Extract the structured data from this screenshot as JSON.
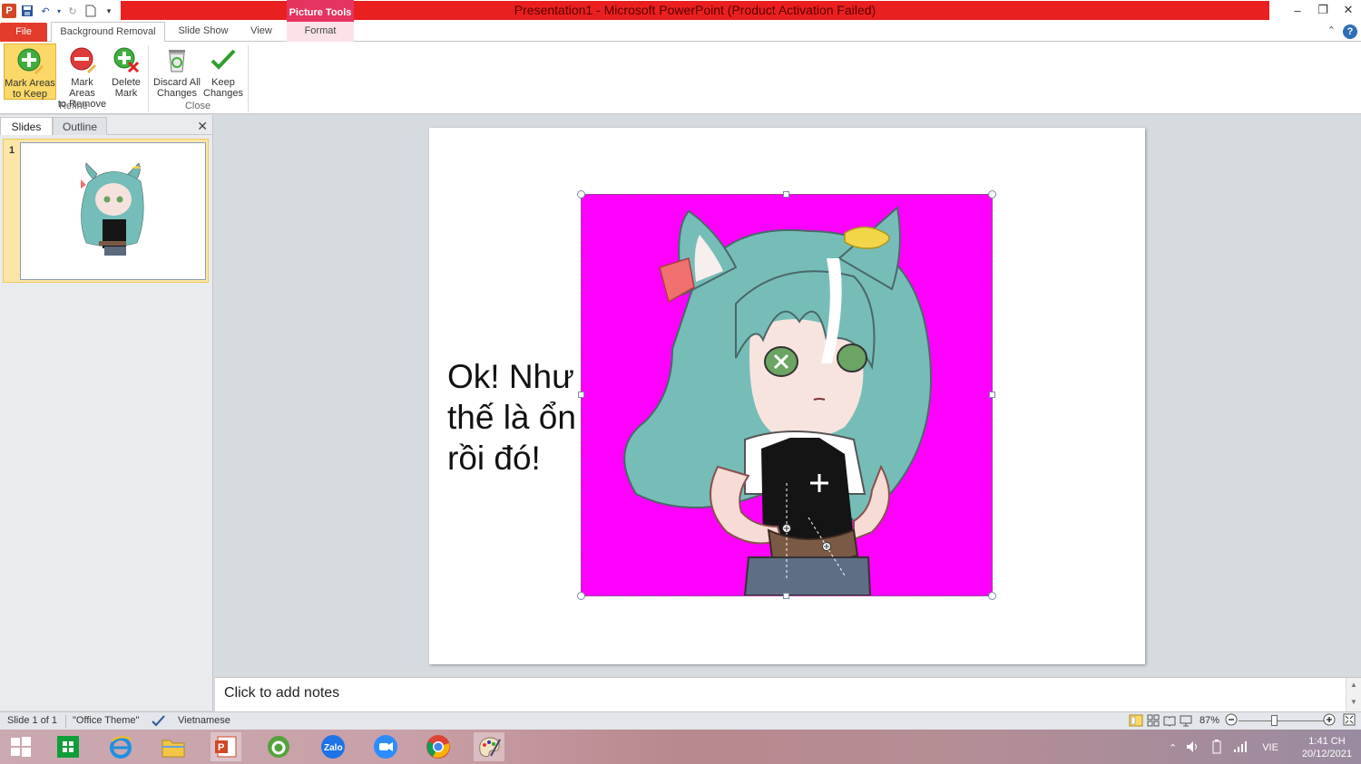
{
  "titlebar": {
    "title": "Presentation1  -  Microsoft PowerPoint (Product Activation Failed)",
    "context_tab": "Picture Tools"
  },
  "tabs": {
    "file": "File",
    "background_removal": "Background Removal",
    "slide_show": "Slide Show",
    "view": "View",
    "format": "Format"
  },
  "ribbon": {
    "mark_keep": [
      "Mark Areas",
      "to Keep"
    ],
    "mark_remove": [
      "Mark Areas",
      "to Remove"
    ],
    "delete_mark": [
      "Delete",
      "Mark"
    ],
    "discard": [
      "Discard All",
      "Changes"
    ],
    "keep": [
      "Keep",
      "Changes"
    ],
    "group_refine": "Refine",
    "group_close": "Close"
  },
  "pane": {
    "slides_tab": "Slides",
    "outline_tab": "Outline",
    "slide_number": "1"
  },
  "slide": {
    "text_lines": [
      "Ok! Như",
      "thế là ổn",
      "rồi đó!"
    ]
  },
  "notes": {
    "placeholder": "Click to add notes"
  },
  "status": {
    "slide_info": "Slide 1 of 1",
    "theme": "\"Office Theme\"",
    "language": "Vietnamese",
    "zoom": "87%"
  },
  "tray": {
    "lang": "VIE",
    "time": "1:41 CH",
    "date": "20/12/2021"
  },
  "colors": {
    "title_red": "#ea1f1f",
    "picture_bg": "#ff00ff",
    "context_pink": "#e4345f"
  }
}
